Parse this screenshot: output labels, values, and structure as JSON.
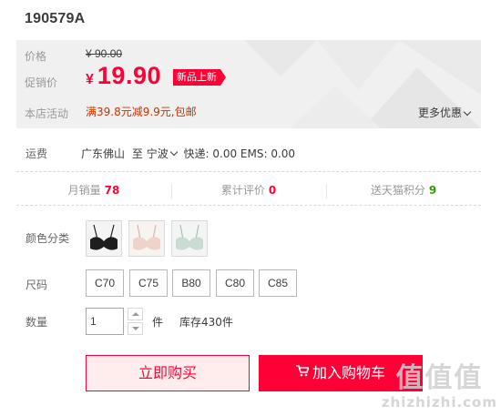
{
  "product": {
    "title": "190579A"
  },
  "price": {
    "label": "价格",
    "original": "¥ 90.00",
    "promo_label": "促销价",
    "currency": "¥",
    "promo_value": "19.90",
    "badge": "新品上新",
    "shop_promo_label": "本店活动",
    "shop_promo_text": "满39.8元减9.9元,包邮",
    "more_promo": "更多优惠"
  },
  "shipping": {
    "label": "运费",
    "from": "广东佛山",
    "to_word": "至",
    "destination": "宁波",
    "detail": "快递: 0.00 EMS: 0.00"
  },
  "stats": [
    {
      "label": "月销量",
      "value": "78"
    },
    {
      "label": "累计评价",
      "value": "0"
    },
    {
      "label": "送天猫积分",
      "value": "9"
    }
  ],
  "colors": {
    "label": "颜色分类",
    "swatches": [
      "black",
      "pink",
      "mint"
    ],
    "accent": "#ff0036"
  },
  "sizes": {
    "label": "尺码",
    "options": [
      "C70",
      "C75",
      "B80",
      "C80",
      "C85"
    ]
  },
  "quantity": {
    "label": "数量",
    "value": "1",
    "unit": "件",
    "stock": "库存430件"
  },
  "actions": {
    "buy_now": "立即购买",
    "add_to_cart": "加入购物车"
  },
  "watermark": {
    "top": "值值值",
    "bottom": "zhizhizhi.com"
  }
}
